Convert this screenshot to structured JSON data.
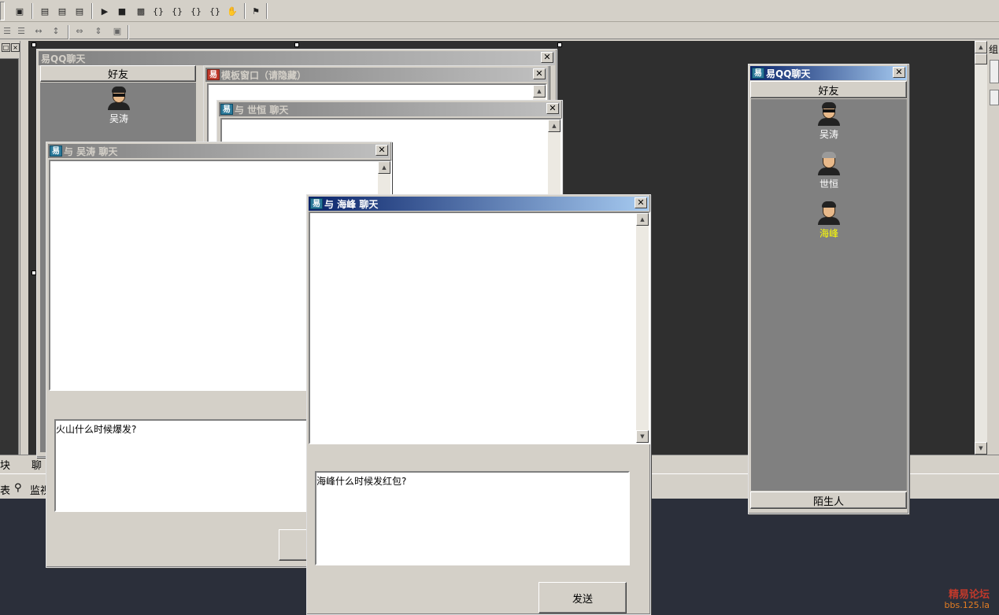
{
  "toolbar": {
    "row1_icons": [
      "find-icon",
      "layout-1-icon",
      "layout-2-icon",
      "layout-3-icon",
      "run-icon",
      "stop-icon",
      "compile-icon",
      "step-into-icon",
      "step-over-icon",
      "step-out-icon",
      "run-to-cursor-icon",
      "hand-icon",
      "debug-icon"
    ],
    "row2_icons": [
      "align-top-icon",
      "align-middle-icon",
      "space-horizontal-icon",
      "space-vertical-icon",
      "same-width-icon",
      "same-height-icon",
      "same-size-icon"
    ]
  },
  "bottom_tabs": {
    "tab_a": "块",
    "tab_b": "聊",
    "tab_c": "表",
    "tab_d": "监视"
  },
  "right_edge_label": "组",
  "designer_window": {
    "title": "易QQ聊天",
    "friends_button": "好友",
    "friend_name": "吴涛"
  },
  "template_window": {
    "title": "模板窗口（请隐藏）"
  },
  "chat_shiheng": {
    "title": "与  世恒  聊天"
  },
  "chat_wutao": {
    "title": "与  吴涛  聊天",
    "input_text": "火山什么时候爆发?"
  },
  "chat_haifeng": {
    "title": "与  海峰  聊天",
    "input_text": "海峰什么时候发红包?",
    "send_button": "发送"
  },
  "qq_window": {
    "title": "易QQ聊天",
    "friends_button": "好友",
    "strangers_button": "陌生人",
    "friends": [
      {
        "name": "吴涛",
        "highlight": false
      },
      {
        "name": "世恒",
        "highlight": false
      },
      {
        "name": "海峰",
        "highlight": true
      }
    ],
    "highlight_color": "#ffff00"
  },
  "watermark": {
    "line1": "精易论坛",
    "line2": "bbs.125.la"
  }
}
